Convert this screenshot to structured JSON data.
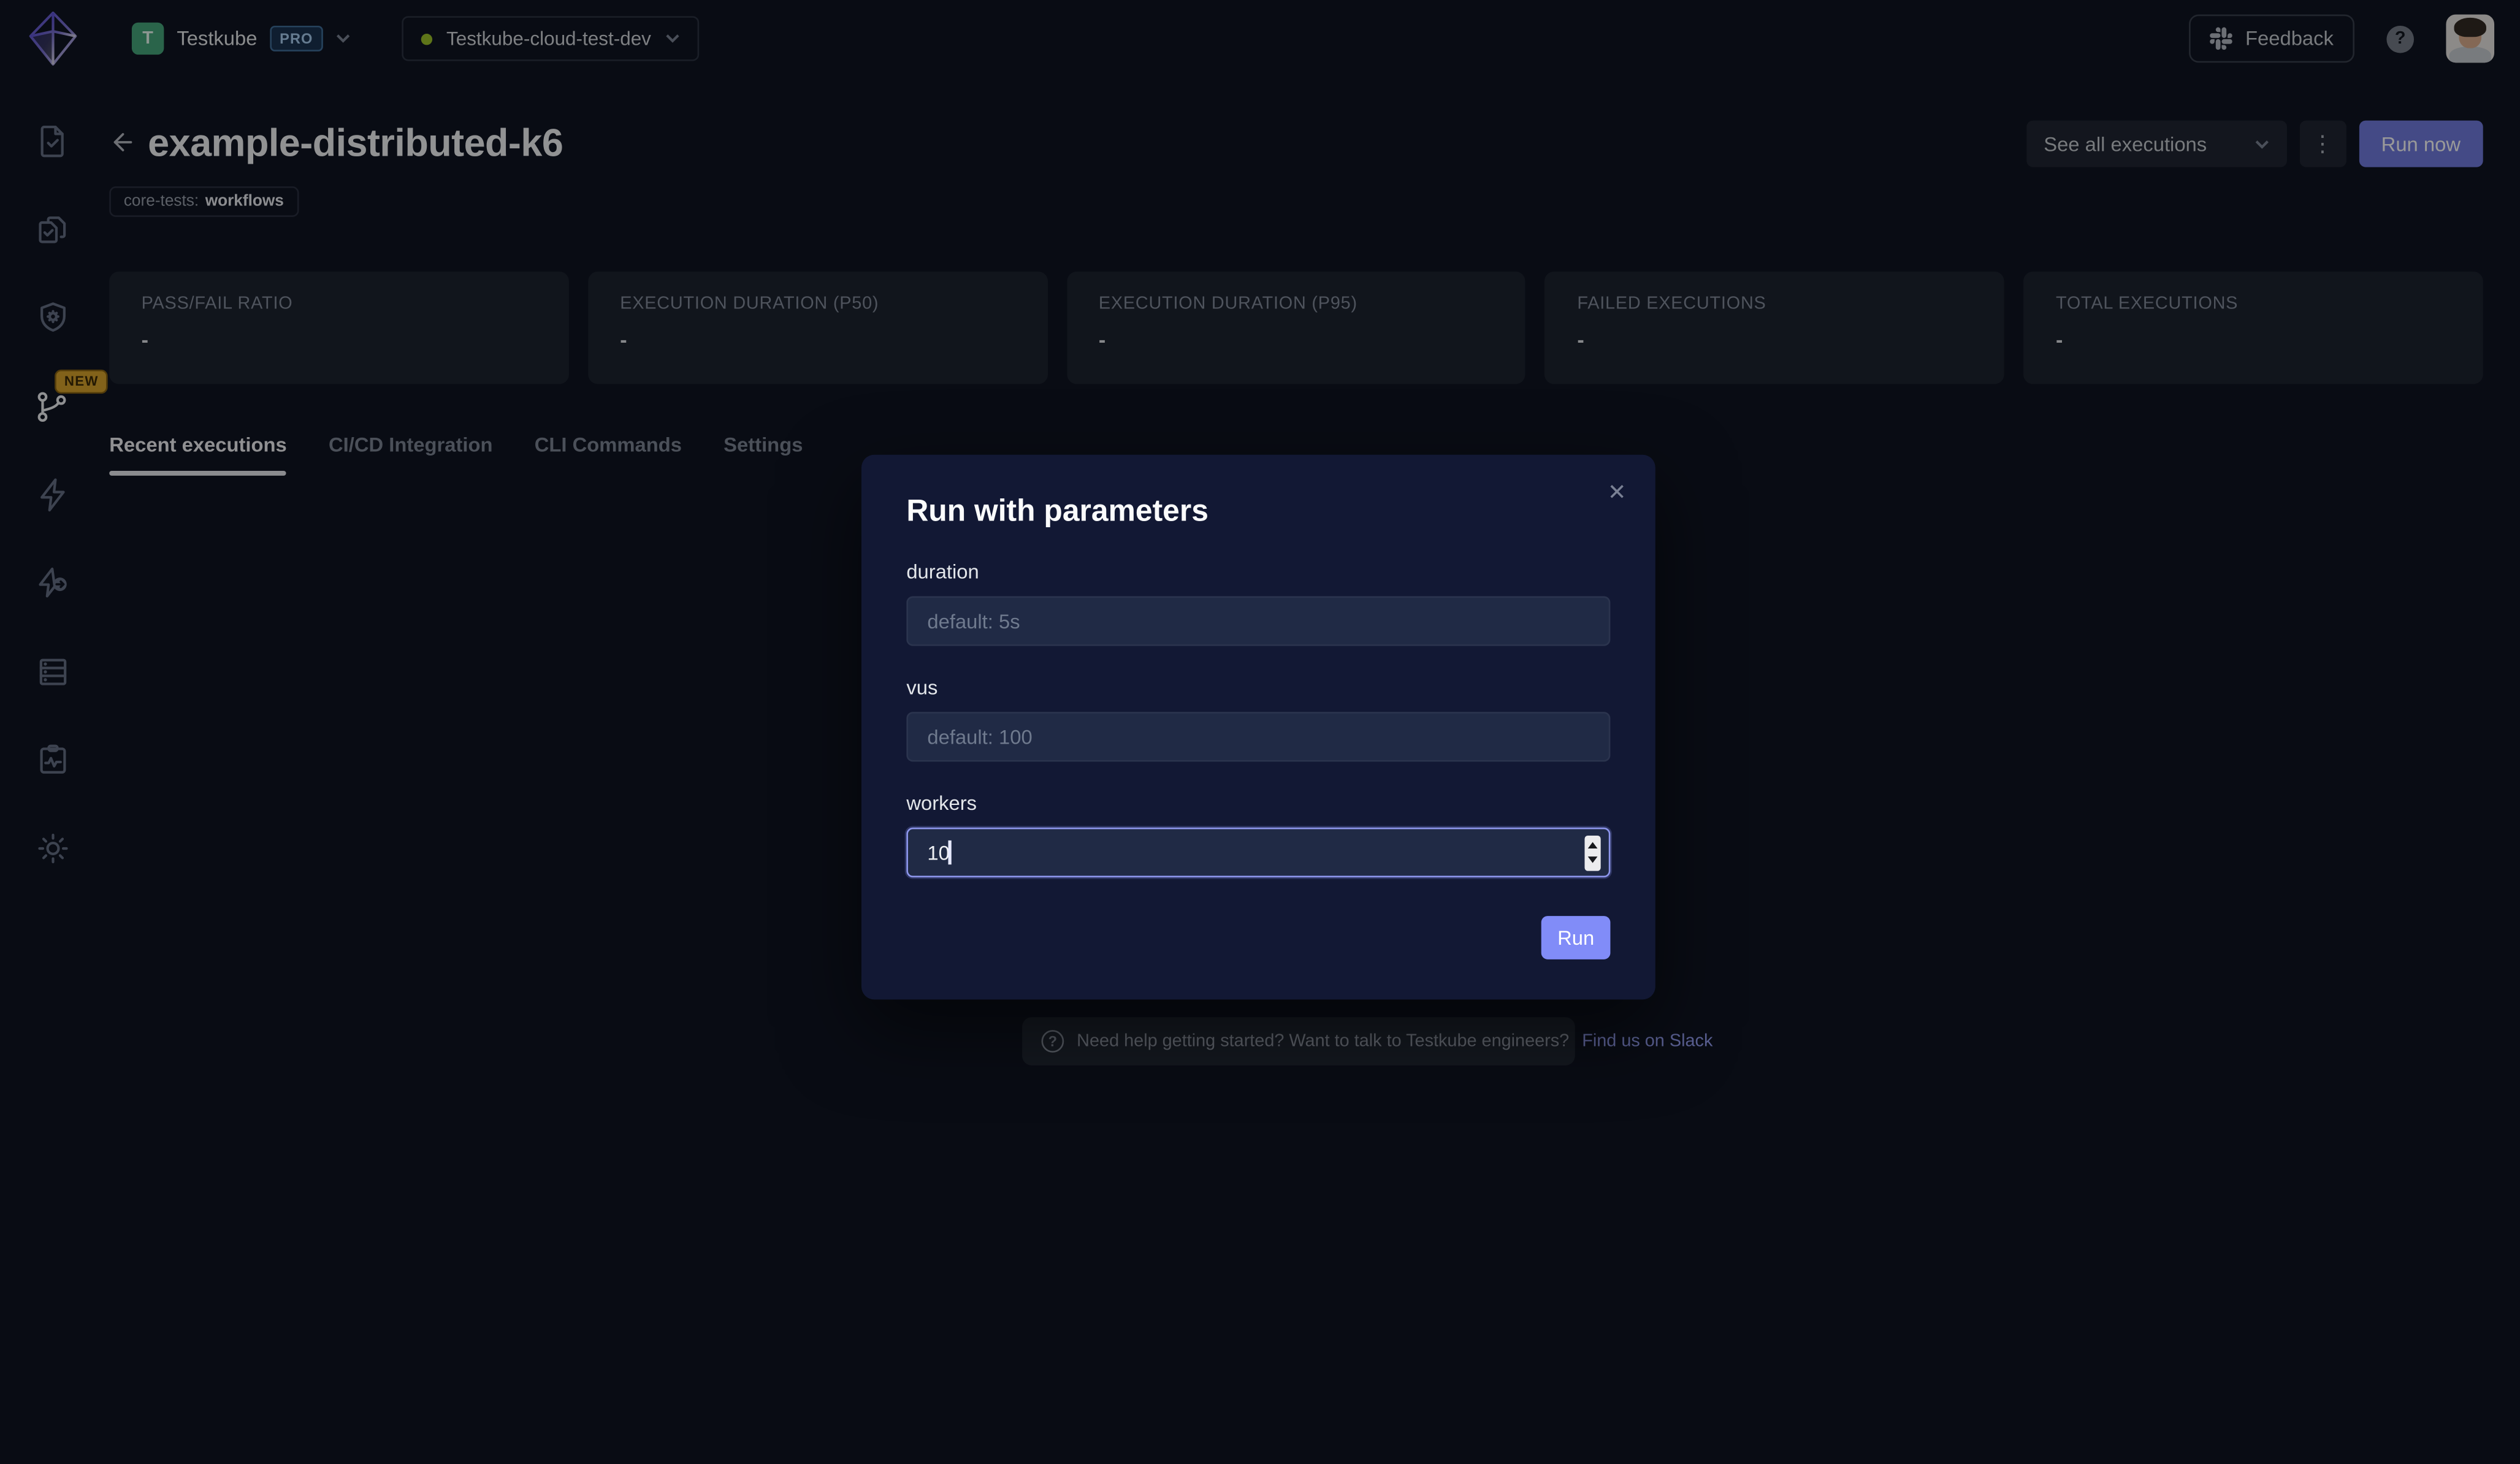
{
  "topbar": {
    "team_initial": "T",
    "team_name": "Testkube",
    "plan_badge": "PRO",
    "environment_name": "Testkube-cloud-test-dev",
    "feedback_label": "Feedback",
    "help_glyph": "?"
  },
  "sidebar": {
    "new_badge": "NEW",
    "icons": [
      "file-check",
      "files-stack-check",
      "shield-gear",
      "git-branch",
      "lightning",
      "lightning-arrow-circle",
      "server-rack",
      "clipboard-pulse",
      "gear"
    ]
  },
  "header": {
    "title": "example-distributed-k6",
    "tag_key": "core-tests:",
    "tag_value": "workflows",
    "see_all_label": "See all executions",
    "kebab_glyph": "⋮",
    "run_now_label": "Run now"
  },
  "metrics": [
    {
      "title": "PASS/FAIL RATIO",
      "value": "-"
    },
    {
      "title": "EXECUTION DURATION (P50)",
      "value": "-"
    },
    {
      "title": "EXECUTION DURATION (P95)",
      "value": "-"
    },
    {
      "title": "FAILED EXECUTIONS",
      "value": "-"
    },
    {
      "title": "TOTAL EXECUTIONS",
      "value": "-"
    }
  ],
  "tabs": [
    {
      "label": "Recent executions",
      "active": true
    },
    {
      "label": "CI/CD Integration",
      "active": false
    },
    {
      "label": "CLI Commands",
      "active": false
    },
    {
      "label": "Settings",
      "active": false
    }
  ],
  "modal": {
    "title": "Run with parameters",
    "close_glyph": "✕",
    "fields": [
      {
        "label": "duration",
        "placeholder": "default: 5s",
        "value": ""
      },
      {
        "label": "vus",
        "placeholder": "default: 100",
        "value": ""
      },
      {
        "label": "workers",
        "placeholder": "",
        "value": "10"
      }
    ],
    "run_label": "Run"
  },
  "help_bar": {
    "icon_glyph": "?",
    "text": "Need help getting started? Want to talk to Testkube engineers?",
    "link_label": "Find us on Slack"
  },
  "colors": {
    "accent": "#818cf8",
    "run_now_dimmed": "#727ce0",
    "new_badge_bg": "#d9a32c",
    "env_dot": "#9dc32b",
    "team_avatar_bg": "#47a77c",
    "pro_badge_text": "#a8cdf0",
    "modal_bg": "#121834",
    "page_bg": "#101522"
  }
}
